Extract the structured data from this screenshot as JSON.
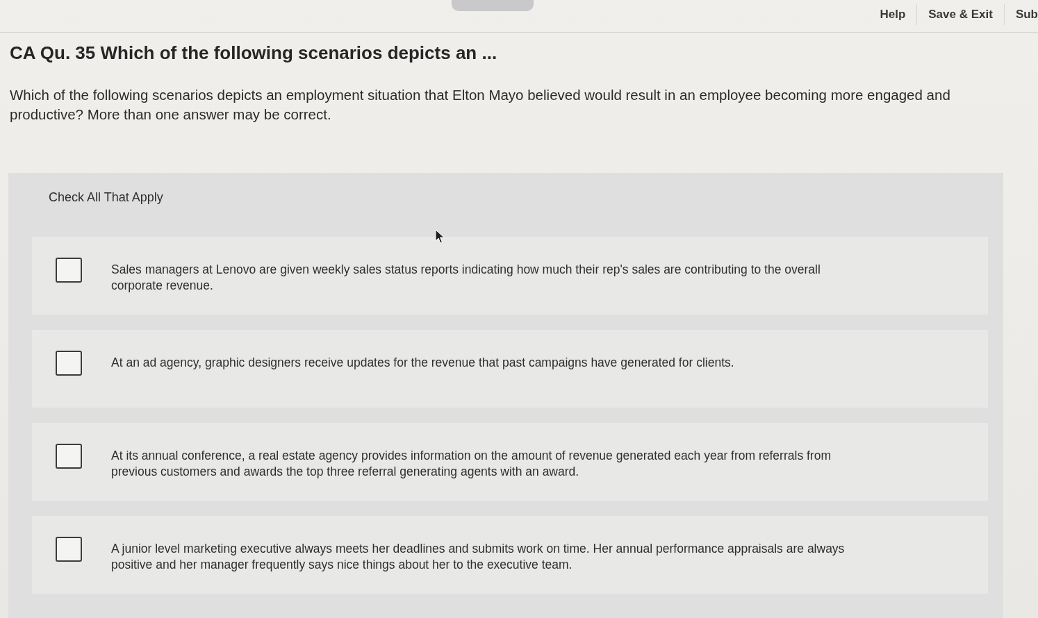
{
  "header": {
    "links": [
      {
        "label": "Help"
      },
      {
        "label": "Save & Exit"
      },
      {
        "label": "Sub"
      }
    ]
  },
  "question": {
    "title": "CA Qu. 35 Which of the following scenarios depicts an ...",
    "prompt": "Which of the following scenarios depicts an employment situation that Elton Mayo believed would result in an employee becoming more engaged and productive? More than one answer may be correct.",
    "instruction": "Check All That Apply",
    "options": [
      {
        "text": "Sales managers at Lenovo are given weekly sales status reports indicating how much their rep's sales are contributing to the overall corporate revenue.",
        "checked": false
      },
      {
        "text": "At an ad agency, graphic designers receive updates for the revenue that past campaigns have generated for clients.",
        "checked": false
      },
      {
        "text": "At its annual conference, a real estate agency provides information on the amount of revenue generated each year from referrals from previous customers and awards the top three referral generating agents with an award.",
        "checked": false
      },
      {
        "text": "A junior level marketing executive always meets her deadlines and submits work on time. Her annual performance appraisals are always positive and her manager frequently says nice things about her to the executive team.",
        "checked": false
      }
    ]
  }
}
